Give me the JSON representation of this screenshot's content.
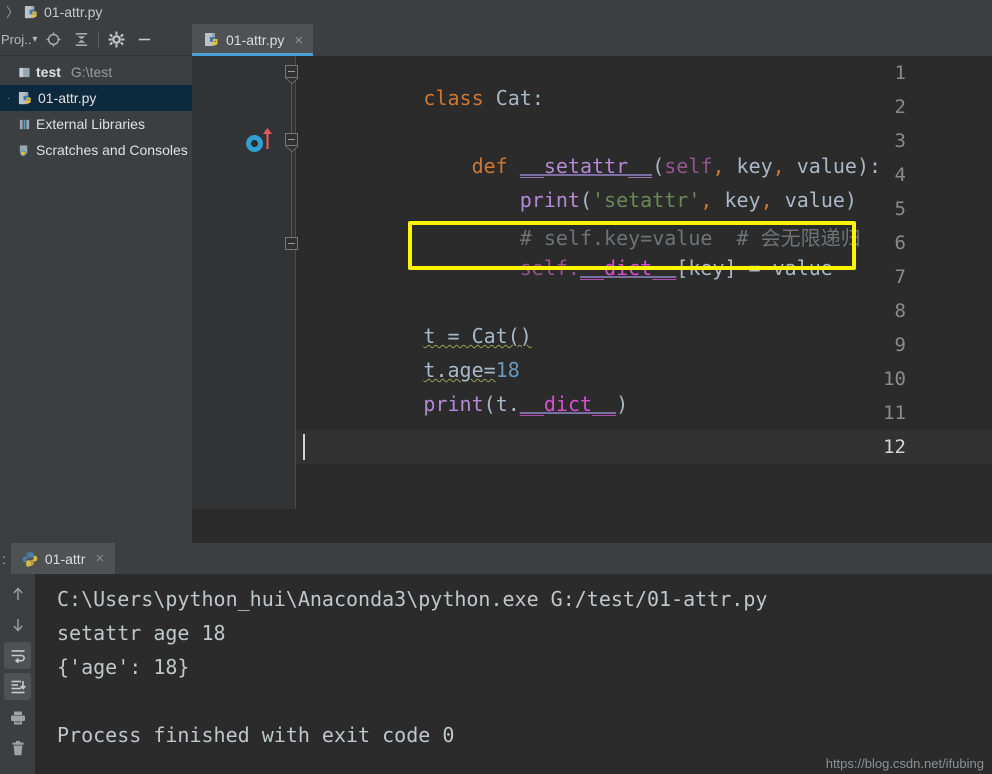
{
  "breadcrumb": {
    "chevron": "〉",
    "file_icon": "python-file-icon",
    "label": "01-attr.py"
  },
  "project_panel": {
    "title": "Proj..",
    "title_caret": "▾",
    "toolbar": [
      {
        "name": "locate-target-icon",
        "tooltip": "Select Opened File"
      },
      {
        "name": "collapse-all-icon",
        "tooltip": "Collapse All"
      },
      {
        "name": "gear-icon",
        "tooltip": "Settings"
      },
      {
        "name": "minimize-icon",
        "tooltip": "Hide"
      }
    ],
    "tree": [
      {
        "twisty": "",
        "icon": "module-icon",
        "label": "test",
        "sub": "G:\\test",
        "selected": false,
        "bold": true
      },
      {
        "twisty": "·",
        "icon": "python-file-icon",
        "label": "01-attr.py",
        "sub": "",
        "selected": true,
        "bold": false
      },
      {
        "twisty": "",
        "icon": "library-icon",
        "label": "External Libraries",
        "sub": "",
        "selected": false,
        "bold": false
      },
      {
        "twisty": "",
        "icon": "scratches-icon",
        "label": "Scratches and Consoles",
        "sub": "",
        "selected": false,
        "bold": false
      }
    ]
  },
  "editor": {
    "tab": {
      "label": "01-attr.py",
      "icon": "python-file-icon",
      "close": "×",
      "active": true
    },
    "line_numbers": [
      "1",
      "2",
      "3",
      "4",
      "5",
      "6",
      "7",
      "8",
      "9",
      "10",
      "11",
      "12"
    ],
    "current_line": 12,
    "gutter_markers": [
      {
        "line": 3,
        "name": "run-class-gutter-icon"
      }
    ],
    "code_lines": [
      {
        "n": 1,
        "text": "class Cat:"
      },
      {
        "n": 2,
        "text": ""
      },
      {
        "n": 3,
        "text": "    def __setattr__(self, key, value):"
      },
      {
        "n": 4,
        "text": "        print('setattr', key, value)"
      },
      {
        "n": 5,
        "text": "        # self.key=value  # 会无限递归"
      },
      {
        "n": 6,
        "text": "        self.__dict__[key] = value"
      },
      {
        "n": 7,
        "text": ""
      },
      {
        "n": 8,
        "text": "t = Cat()"
      },
      {
        "n": 9,
        "text": "t.age=18"
      },
      {
        "n": 10,
        "text": "print(t.__dict__)"
      },
      {
        "n": 11,
        "text": ""
      },
      {
        "n": 12,
        "text": ""
      }
    ],
    "tokens": {
      "l1_kw": "class",
      "l1_name": "Cat",
      "l1_colon": ":",
      "l3_kw": "def",
      "l3_name": "__setattr__",
      "l3_open": "(",
      "l3_self": "self",
      "l3_c1": ",",
      "l3_key": " key",
      "l3_c2": ",",
      "l3_value": " value",
      "l3_close": "):",
      "l4_print": "print",
      "l4_open": "(",
      "l4_str": "'setattr'",
      "l4_c1": ",",
      "l4_key": " key",
      "l4_c2": ",",
      "l4_value": " value",
      "l4_close": ")",
      "l5_comment": "# self.key=value  # 会无限递归",
      "l6_self": "self.",
      "l6_dict": "__dict__",
      "l6_rest": "[key] = value",
      "l8_text": "t = Cat()",
      "l9_a": "t.age=",
      "l9_num": "18",
      "l10_print": "print",
      "l10_open": "(",
      "l10_t": "t.",
      "l10_dict": "__dict__",
      "l10_close": ")"
    },
    "highlight_box": {
      "color": "#fff500",
      "target_line": 6
    }
  },
  "console": {
    "colon": ":",
    "tab": {
      "label": "01-attr",
      "icon": "python-icon",
      "close": "×"
    },
    "sidebar_buttons": [
      {
        "name": "scroll-up-icon",
        "glyph": "↑",
        "boxed": false
      },
      {
        "name": "scroll-down-icon",
        "glyph": "↓",
        "boxed": false
      },
      {
        "name": "soft-wrap-icon",
        "glyph": "",
        "boxed": true
      },
      {
        "name": "scroll-to-end-icon",
        "glyph": "",
        "boxed": true
      },
      {
        "name": "print-icon",
        "glyph": "",
        "boxed": false
      },
      {
        "name": "clear-all-icon",
        "glyph": "",
        "boxed": false
      }
    ],
    "output_lines": [
      "C:\\Users\\python_hui\\Anaconda3\\python.exe G:/test/01-attr.py",
      "setattr age 18",
      "{'age': 18}",
      "",
      "Process finished with exit code 0"
    ]
  },
  "watermark": "https://blog.csdn.net/ifubing"
}
